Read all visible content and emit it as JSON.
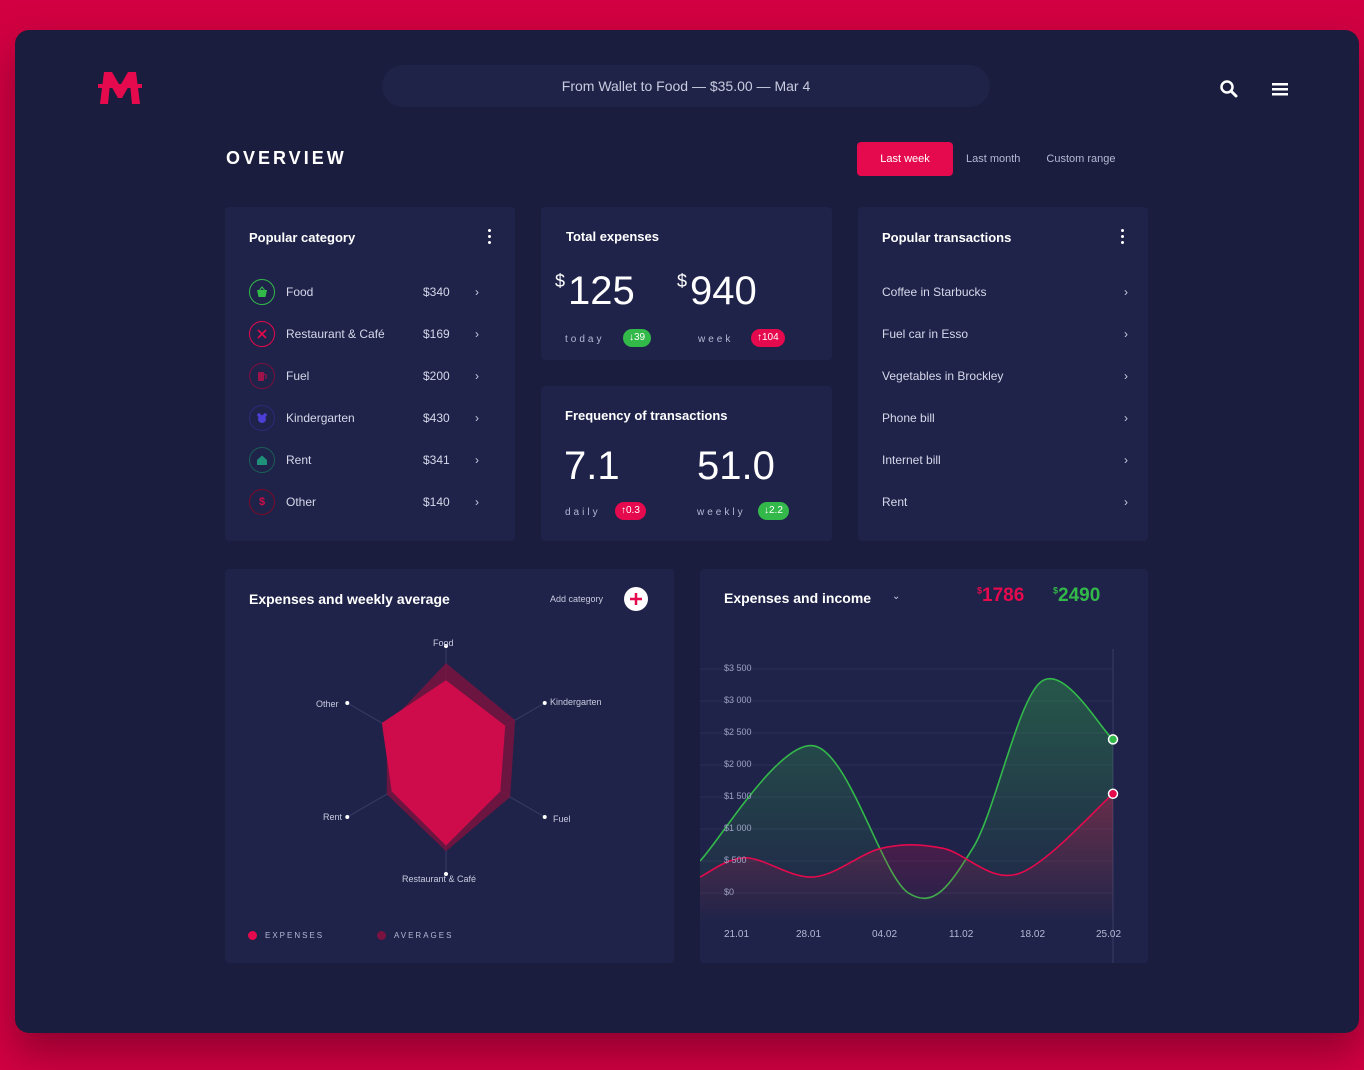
{
  "app": {
    "brand_colors": {
      "accent": "#e5094d",
      "background": "#1a1d3d",
      "card": "#1f2349",
      "green": "#33b84a"
    }
  },
  "header": {
    "notification": "From Wallet to Food — $35.00 — Mar 4",
    "icons": [
      "logo-icon",
      "search-icon",
      "menu-icon"
    ]
  },
  "overview": {
    "title": "OVERVIEW",
    "tabs": [
      {
        "label": "Last week",
        "active": true
      },
      {
        "label": "Last month",
        "active": false
      },
      {
        "label": "Custom range",
        "active": false
      }
    ]
  },
  "popular_category": {
    "title": "Popular category",
    "items": [
      {
        "label": "Food",
        "amount": "$340",
        "icon": "basket-icon",
        "color": "#33b84a"
      },
      {
        "label": "Restaurant & Café",
        "amount": "$169",
        "icon": "cutlery-icon",
        "color": "#e5094d"
      },
      {
        "label": "Fuel",
        "amount": "$200",
        "icon": "fuel-icon",
        "color": "#a0124a"
      },
      {
        "label": "Kindergarten",
        "amount": "$430",
        "icon": "teddy-icon",
        "color": "#4b3fd6"
      },
      {
        "label": "Rent",
        "amount": "$341",
        "icon": "home-icon",
        "color": "#1f8f7a"
      },
      {
        "label": "Other",
        "amount": "$140",
        "icon": "dollar-icon",
        "color": "#b80c3c"
      }
    ]
  },
  "total_expenses": {
    "title": "Total expenses",
    "currency": "$",
    "today_value": "125",
    "today_label": "today",
    "today_badge": "↓39",
    "week_value": "940",
    "week_label": "week",
    "week_badge": "↑104"
  },
  "frequency": {
    "title": "Frequency of transactions",
    "daily_value": "7.1",
    "daily_label": "daily",
    "daily_badge": "↑0.3",
    "weekly_value": "51.0",
    "weekly_label": "weekly",
    "weekly_badge": "↓2.2"
  },
  "popular_transactions": {
    "title": "Popular transactions",
    "items": [
      "Coffee in Starbucks",
      "Fuel car in Esso",
      "Vegetables in Brockley",
      "Phone bill",
      "Internet bill",
      "Rent"
    ]
  },
  "radar": {
    "title": "Expenses and weekly average",
    "add_label": "Add category",
    "axes": [
      "Food",
      "Kindergarten",
      "Fuel",
      "Restaurant & Café",
      "Rent",
      "Other"
    ],
    "expenses": [
      0.7,
      0.6,
      0.55,
      0.75,
      0.55,
      0.65
    ],
    "averages": [
      0.85,
      0.7,
      0.65,
      0.8,
      0.6,
      0.6
    ],
    "legend": [
      "EXPENSES",
      "AVERAGES"
    ]
  },
  "chart_data": {
    "type": "line",
    "title": "Expenses and income",
    "expenses_total": "1786",
    "income_total": "2490",
    "currency": "$",
    "x": [
      "21.01",
      "28.01",
      "04.02",
      "11.02",
      "18.02",
      "25.02"
    ],
    "yticks": [
      "$3 500",
      "$3 000",
      "$2 500",
      "$2 000",
      "$1 500",
      "$1 000",
      "$ 500",
      "$0"
    ],
    "ylim": [
      0,
      3500
    ],
    "series": [
      {
        "color": "#33b84a",
        "points": [
          [
            0,
            500
          ],
          [
            1.5,
            2300
          ],
          [
            2.75,
            0
          ],
          [
            3.6,
            700
          ],
          [
            4.5,
            3300
          ],
          [
            5.45,
            2400
          ]
        ]
      },
      {
        "color": "#e5094d",
        "points": [
          [
            0,
            250
          ],
          [
            0.6,
            550
          ],
          [
            1.5,
            250
          ],
          [
            2.4,
            700
          ],
          [
            3.2,
            700
          ],
          [
            4.2,
            300
          ],
          [
            5.45,
            1550
          ]
        ]
      }
    ]
  }
}
